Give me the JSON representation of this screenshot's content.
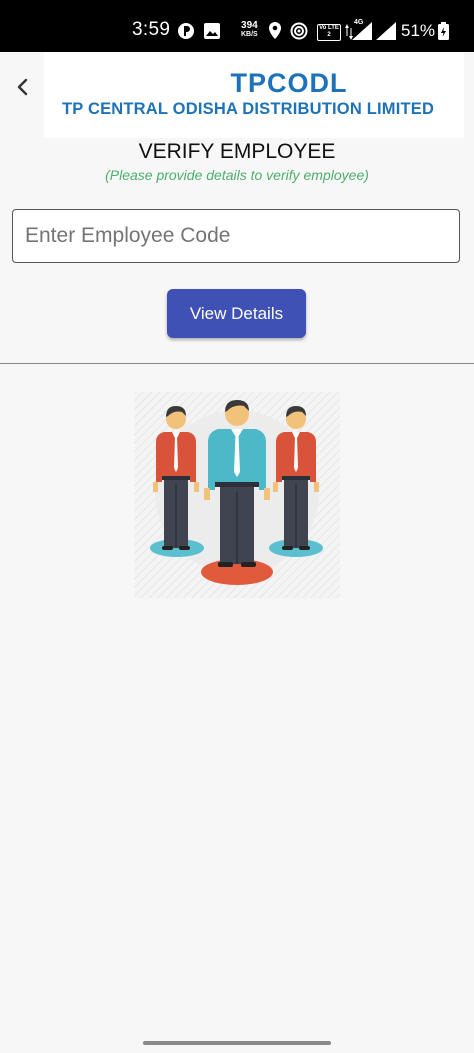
{
  "status_bar": {
    "time": "3:59",
    "speed_value": "394",
    "speed_unit": "KB/S",
    "lte_label": "Vo LTE 2",
    "network_label": "4G",
    "battery_percent": "51%"
  },
  "header": {
    "logo_main": "TPCODL",
    "logo_sub": "TP CENTRAL ODISHA DISTRIBUTION LIMITED"
  },
  "page": {
    "title": "VERIFY EMPLOYEE",
    "subtitle": "(Please provide details to verify employee)"
  },
  "form": {
    "employee_code_placeholder": "Enter Employee Code",
    "employee_code_value": "",
    "view_details_label": "View Details"
  },
  "colors": {
    "brand_blue": "#1e73b8",
    "button": "#3f51b5",
    "subtitle_green": "#4cae6a"
  }
}
